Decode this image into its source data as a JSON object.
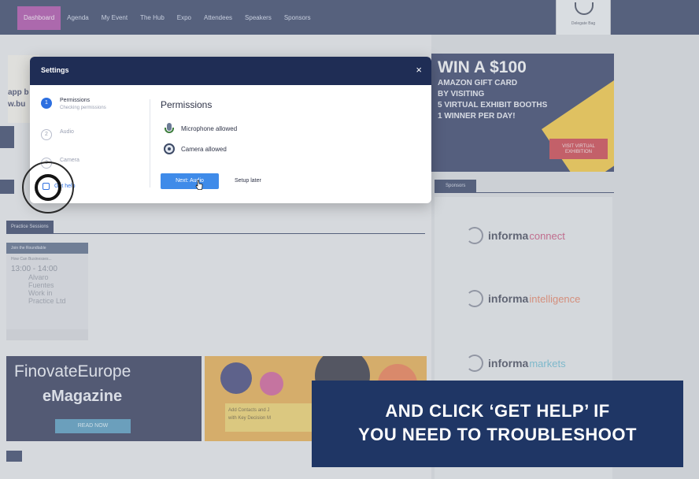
{
  "nav": {
    "items": [
      "Dashboard",
      "Agenda",
      "My Event",
      "The Hub",
      "Expo",
      "Attendees",
      "Speakers",
      "Sponsors"
    ],
    "active_index": 0,
    "badge_label": "Delegate Bag"
  },
  "background": {
    "banner_text_1": "app b",
    "banner_text_2": "w.bu",
    "section_tab": "Practice Sessions",
    "session": {
      "head": "Join the Roundtable",
      "sub": "How Can Businesses...",
      "time": "13:00 - 14:00",
      "desc": [
        "Alvaro",
        "Fuentes",
        "Work in",
        "Practice Ltd"
      ]
    },
    "finovate": {
      "title": "FinovateEurope",
      "subtitle": "eMagazine",
      "button": "READ NOW"
    },
    "contacts": {
      "line1": "Add Contacts and J",
      "line2": "with Key Decision M"
    }
  },
  "ad": {
    "headline": "WIN A $100",
    "line1": "AMAZON GIFT CARD",
    "line2": "BY VISITING",
    "line3": "5 VIRTUAL EXHIBIT BOOTHS",
    "line4": "1 WINNER PER DAY!",
    "button": "VISIT VIRTUAL EXHIBITION"
  },
  "sponsors": {
    "tab": "Sponsors",
    "logos": [
      {
        "brand": "informa",
        "suffix": "connect"
      },
      {
        "brand": "informa",
        "suffix": "intelligence"
      },
      {
        "brand": "informa",
        "suffix": "markets"
      }
    ]
  },
  "modal": {
    "title": "Settings",
    "close": "×",
    "steps": [
      {
        "num": "1",
        "label": "Permissions",
        "sublabel": "Checking permissions"
      },
      {
        "num": "2",
        "label": "Audio",
        "sublabel": ""
      },
      {
        "num": "3",
        "label": "Camera",
        "sublabel": ""
      }
    ],
    "get_help": "Get help",
    "panel_title": "Permissions",
    "mic": "Microphone allowed",
    "camera": "Camera allowed",
    "next_button": "Next: Audio",
    "later_button": "Setup later"
  },
  "caption": {
    "line1": "AND CLICK ‘GET HELP’ IF",
    "line2": "YOU NEED TO TROUBLESHOOT"
  },
  "colors": {
    "navy": "#1f2d55",
    "accent_blue": "#3f8be9",
    "active_nav": "#a43a9e",
    "caption_bg": "#1f3665"
  }
}
